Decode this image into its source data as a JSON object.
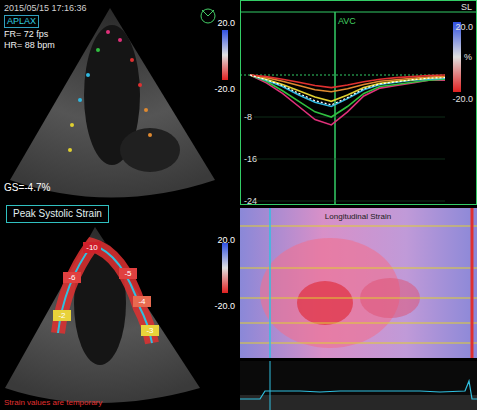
{
  "top_left": {
    "timestamp": "2015/05/15 17:16:36",
    "view": "APLAX",
    "frame_rate": "FR= 72 fps",
    "heart_rate": "HR= 88 bpm",
    "global_strain": "GS=-4.7%",
    "scale_max": "20.0",
    "scale_min": "-20.0"
  },
  "bottom_left": {
    "title": "Peak Systolic Strain",
    "note": "Strain values are temporary",
    "scale_max": "20.0",
    "scale_min": "-20.0",
    "segments": [
      {
        "value": "-2",
        "color": "#e8d23a"
      },
      {
        "value": "-6",
        "color": "#e04040"
      },
      {
        "value": "-10",
        "color": "#d0202a"
      },
      {
        "value": "-5",
        "color": "#e04040"
      },
      {
        "value": "-4",
        "color": "#e86a50"
      },
      {
        "value": "-3",
        "color": "#e8d23a"
      }
    ]
  },
  "chart": {
    "unit_label": "SL",
    "scale_max": "20.0",
    "scale_unit": "%",
    "scale_min": "-20.0",
    "marker": "AVC",
    "y_ticks": [
      "-8",
      "-16",
      "-24"
    ],
    "series": [
      {
        "color": "#e0307a",
        "dashed": false,
        "values": [
          0,
          -1.5,
          -3.5,
          -6,
          -8.5,
          -9.5,
          -7,
          -4,
          -2.5,
          -2,
          -1.5,
          -1,
          -1
        ]
      },
      {
        "color": "#30c040",
        "dashed": false,
        "values": [
          0,
          -1.2,
          -3,
          -5,
          -7,
          -8,
          -6,
          -3.5,
          -2.2,
          -1.8,
          -1.4,
          -1,
          -0.8
        ]
      },
      {
        "color": "#30b8e0",
        "dashed": false,
        "values": [
          0,
          -1,
          -2.2,
          -3.8,
          -5.2,
          -6,
          -4.5,
          -2.8,
          -1.8,
          -1.4,
          -1,
          -0.8,
          -0.6
        ]
      },
      {
        "color": "#e0d030",
        "dashed": false,
        "values": [
          0,
          -0.8,
          -1.8,
          -3,
          -4.2,
          -5,
          -3.8,
          -2.4,
          -1.6,
          -1.2,
          -0.9,
          -0.6,
          -0.4
        ]
      },
      {
        "color": "#e08a30",
        "dashed": false,
        "values": [
          0,
          -0.5,
          -1.2,
          -2,
          -2.8,
          -3.2,
          -2.6,
          -1.8,
          -1.2,
          -0.9,
          -0.6,
          -0.4,
          -0.3
        ]
      },
      {
        "color": "#e03030",
        "dashed": false,
        "values": [
          0,
          -0.3,
          -0.8,
          -1.4,
          -2,
          -2.4,
          -1.9,
          -1.3,
          -0.8,
          -0.5,
          -0.3,
          -0.1,
          0
        ]
      },
      {
        "color": "#ffffff",
        "dashed": true,
        "values": [
          0,
          -0.9,
          -2,
          -3.5,
          -4.9,
          -5.7,
          -4.3,
          -2.6,
          -1.7,
          -1.3,
          -0.9,
          -0.6,
          -0.5
        ]
      }
    ]
  },
  "map": {
    "title": "Longitudinal Strain"
  }
}
